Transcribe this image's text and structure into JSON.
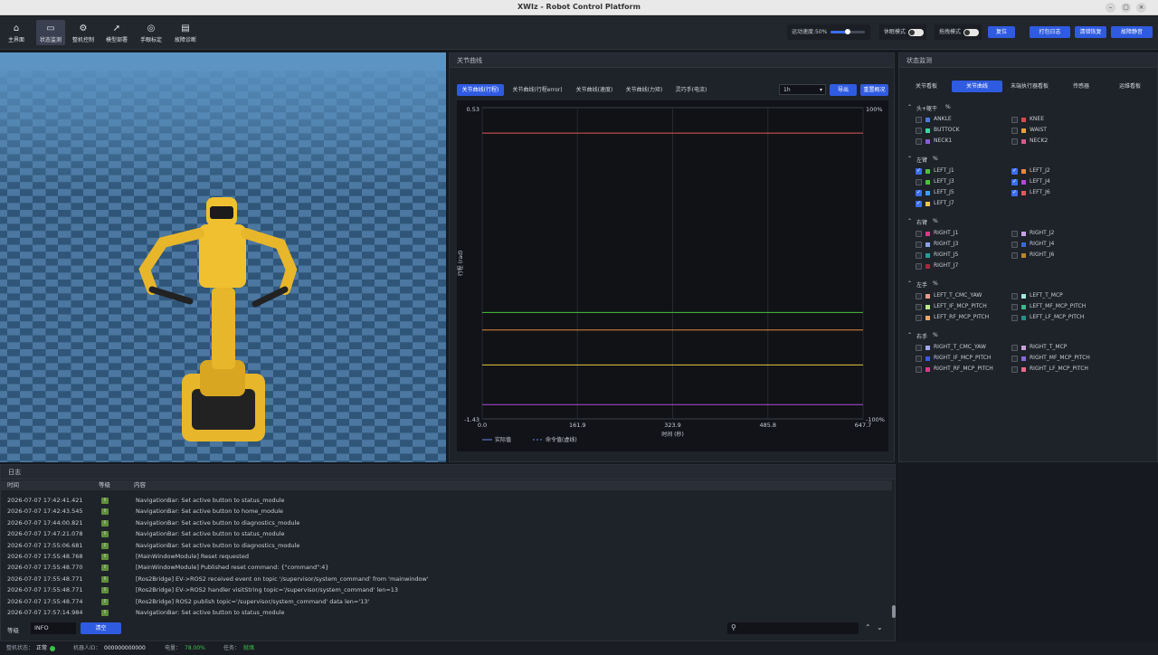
{
  "window": {
    "title": "XWIz - Robot Control Platform"
  },
  "nav": [
    {
      "label": "主界面",
      "icon": "home-icon",
      "glyph": "⌂"
    },
    {
      "label": "状态监测",
      "icon": "monitor-icon",
      "glyph": "▭"
    },
    {
      "label": "整机控制",
      "icon": "robot-icon",
      "glyph": "⚙"
    },
    {
      "label": "模型部署",
      "icon": "rocket-icon",
      "glyph": "➚"
    },
    {
      "label": "手眼标定",
      "icon": "target-icon",
      "glyph": "◎"
    },
    {
      "label": "故障诊断",
      "icon": "document-icon",
      "glyph": "▤"
    }
  ],
  "toolbar": {
    "speed_label": "运动速度:50%",
    "speed_value": 0.5,
    "rest_label": "休眠模式",
    "drag_label": "拖拽模式",
    "reset": "复位",
    "pack_log": "打包日志",
    "clear_fault": "清错恢复",
    "fault_reset": "故障静音"
  },
  "center": {
    "title": "关节曲线",
    "tabs": [
      "关节曲线(行程)",
      "关节曲线(行程error)",
      "关节曲线(速度)",
      "关节曲线(力矩)",
      "灵巧手(电流)"
    ],
    "range": "1h",
    "export": "导出",
    "reset_zoom": "重置概况"
  },
  "chart_data": {
    "type": "line",
    "ylabel": "行程 (rad)",
    "xlabel": "时间 (秒)",
    "ylim": [
      -1.43,
      0.53
    ],
    "y_ticks": [
      "0.53",
      "-1.43"
    ],
    "y2_ticks": [
      "100%",
      "-100%"
    ],
    "xlim": [
      0,
      647.7
    ],
    "x_ticks": [
      "0.0",
      "161.9",
      "323.9",
      "485.8",
      "647.7"
    ],
    "legend": [
      "实际值",
      "命令值(虚线)"
    ],
    "series": [
      {
        "color": "#e05a5a",
        "y": 0.37
      },
      {
        "color": "#4cc23a",
        "y": -0.76
      },
      {
        "color": "#e8883a",
        "y": -0.87
      },
      {
        "color": "#e8c83a",
        "y": -1.09
      },
      {
        "color": "#b04ad8",
        "y": -1.34
      }
    ]
  },
  "right": {
    "title": "状态监测",
    "tabs": [
      "关节看板",
      "关节曲线",
      "末端执行器看板",
      "传感器",
      "运维看板"
    ],
    "sections": [
      {
        "name": "头+躯干",
        "pct": "%",
        "items": [
          {
            "n": "ANKLE",
            "c": "#4a7ad8",
            "on": false
          },
          {
            "n": "KNEE",
            "c": "#d84a4a",
            "on": false
          },
          {
            "n": "BUTTOCK",
            "c": "#3ad8a0",
            "on": false
          },
          {
            "n": "WAIST",
            "c": "#e8a03a",
            "on": false
          },
          {
            "n": "NECK1",
            "c": "#8a5ad8",
            "on": false
          },
          {
            "n": "NECK2",
            "c": "#d85a8a",
            "on": false
          }
        ]
      },
      {
        "name": "左臂",
        "pct": "%",
        "items": [
          {
            "n": "LEFT_J1",
            "c": "#4cc23a",
            "on": true
          },
          {
            "n": "LEFT_J2",
            "c": "#e8883a",
            "on": true
          },
          {
            "n": "LEFT_J3",
            "c": "#4cc23a",
            "on": false
          },
          {
            "n": "LEFT_J4",
            "c": "#b04ad8",
            "on": true
          },
          {
            "n": "LEFT_J5",
            "c": "#3aa0e8",
            "on": true
          },
          {
            "n": "LEFT_J6",
            "c": "#e05a5a",
            "on": true
          },
          {
            "n": "LEFT_J7",
            "c": "#e8c83a",
            "on": true
          }
        ]
      },
      {
        "name": "右臂",
        "pct": "%",
        "items": [
          {
            "n": "RIGHT_J1",
            "c": "#d83a8a",
            "on": false
          },
          {
            "n": "RIGHT_J2",
            "c": "#c8a0e8",
            "on": false
          },
          {
            "n": "RIGHT_J3",
            "c": "#8aa0e8",
            "on": false
          },
          {
            "n": "RIGHT_J4",
            "c": "#3a6ad8",
            "on": false
          },
          {
            "n": "RIGHT_J5",
            "c": "#2a9a9a",
            "on": false
          },
          {
            "n": "RIGHT_J6",
            "c": "#b8862a",
            "on": false
          },
          {
            "n": "RIGHT_J7",
            "c": "#a02a3a",
            "on": false
          }
        ]
      },
      {
        "name": "左手",
        "pct": "%",
        "items": [
          {
            "n": "LEFT_T_CMC_YAW",
            "c": "#e89a8a",
            "on": false
          },
          {
            "n": "LEFT_T_MCP",
            "c": "#a0e8e0",
            "on": false
          },
          {
            "n": "LEFT_IF_MCP_PITCH",
            "c": "#b8e88a",
            "on": false
          },
          {
            "n": "LEFT_MF_MCP_PITCH",
            "c": "#3ab88a",
            "on": false
          },
          {
            "n": "LEFT_RF_MCP_PITCH",
            "c": "#e8a86a",
            "on": false
          },
          {
            "n": "LEFT_LF_MCP_PITCH",
            "c": "#2a8a8a",
            "on": false
          }
        ]
      },
      {
        "name": "右手",
        "pct": "%",
        "items": [
          {
            "n": "RIGHT_T_CMC_YAW",
            "c": "#a0a8e8",
            "on": false
          },
          {
            "n": "RIGHT_T_MCP",
            "c": "#c8a0d8",
            "on": false
          },
          {
            "n": "RIGHT_IF_MCP_PITCH",
            "c": "#3a5ae8",
            "on": false
          },
          {
            "n": "RIGHT_MF_MCP_PITCH",
            "c": "#8a6ad8",
            "on": false
          },
          {
            "n": "RIGHT_RF_MCP_PITCH",
            "c": "#d83a8a",
            "on": false
          },
          {
            "n": "RIGHT_LF_MCP_PITCH",
            "c": "#e86a8a",
            "on": false
          }
        ]
      }
    ]
  },
  "log": {
    "title": "日志",
    "headers": [
      "时间",
      "等级",
      "内容"
    ],
    "level_label": "I",
    "rows": [
      {
        "t": "2026-07-07 17:42:41.421",
        "m": "NavigationBar: Set active button to status_module"
      },
      {
        "t": "2026-07-07 17:42:43.545",
        "m": "NavigationBar: Set active button to home_module"
      },
      {
        "t": "2026-07-07 17:44:00.821",
        "m": "NavigationBar: Set active button to diagnostics_module"
      },
      {
        "t": "2026-07-07 17:47:21.078",
        "m": "NavigationBar: Set active button to status_module"
      },
      {
        "t": "2026-07-07 17:55:06.681",
        "m": "NavigationBar: Set active button to diagnostics_module"
      },
      {
        "t": "2026-07-07 17:55:48.768",
        "m": "[MainWindowModule] Reset requested"
      },
      {
        "t": "2026-07-07 17:55:48.770",
        "m": "[MainWindowModule] Published reset command: {\"command\":4}"
      },
      {
        "t": "2026-07-07 17:55:48.771",
        "m": "[Ros2Bridge] EV->ROS2 received event on topic '/supervisor/system_command' from 'mainwindow'"
      },
      {
        "t": "2026-07-07 17:55:48.771",
        "m": "[Ros2Bridge] EV->ROS2 handler visitString topic='/supervisor/system_command' len=13"
      },
      {
        "t": "2026-07-07 17:55:48.774",
        "m": "[Ros2Bridge] ROS2 publish topic='/supervisor/system_command' data len='13'"
      },
      {
        "t": "2026-07-07 17:57:14.984",
        "m": "NavigationBar: Set active button to status_module"
      }
    ],
    "level_filter_label": "等级",
    "level_value": "INFO",
    "clear": "清空"
  },
  "status": {
    "machine_label": "整机状态：",
    "machine_value": "正常",
    "robot_id_label": "机器人ID：",
    "robot_id": "000000000000",
    "battery_label": "电量：",
    "battery": "78.00%",
    "task_label": "任务：",
    "task": "就绪"
  }
}
